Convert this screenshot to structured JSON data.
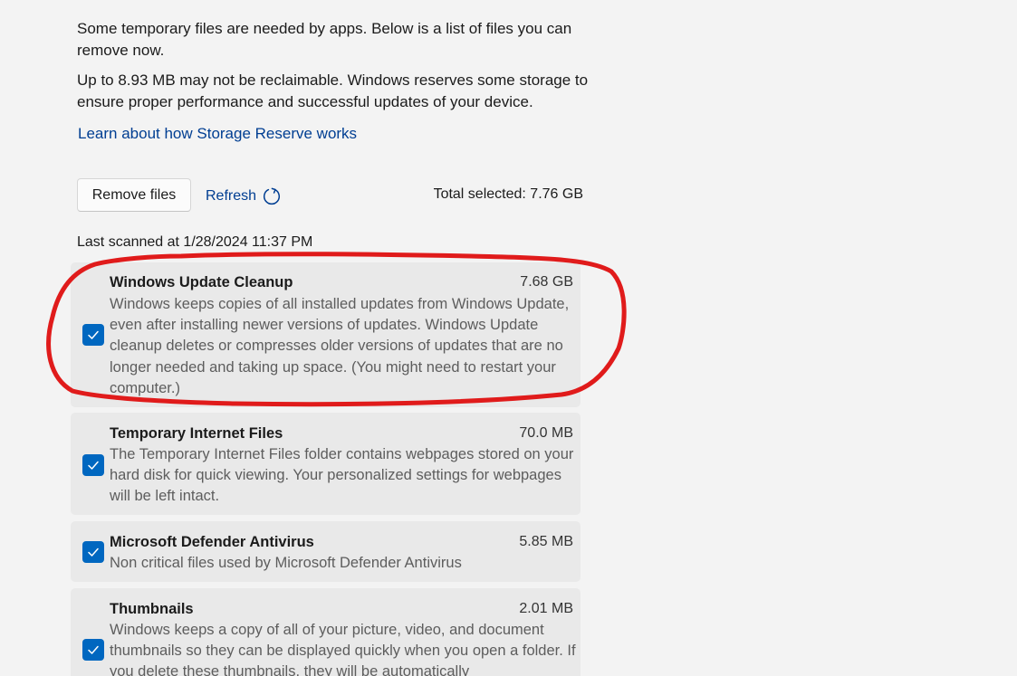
{
  "intro": {
    "paragraph1": "Some temporary files are needed by apps. Below is a list of files you can remove now.",
    "paragraph2": "Up to 8.93 MB may not be reclaimable. Windows reserves some storage to ensure proper performance and successful updates of your device.",
    "learn_link": "Learn about how Storage Reserve works"
  },
  "toolbar": {
    "remove_label": "Remove files",
    "refresh_label": "Refresh",
    "total_selected": "Total selected: 7.76 GB"
  },
  "last_scanned": "Last scanned at 1/28/2024 11:37 PM",
  "items": [
    {
      "title": "Windows Update Cleanup",
      "size": "7.68 GB",
      "description": "Windows keeps copies of all installed updates from Windows Update, even after installing newer versions of updates. Windows Update cleanup deletes or compresses older versions of updates that are no longer needed and taking up space. (You might need to restart your computer.)",
      "checked": true
    },
    {
      "title": "Temporary Internet Files",
      "size": "70.0 MB",
      "description": "The Temporary Internet Files folder contains webpages stored on your hard disk for quick viewing. Your personalized settings for webpages will be left intact.",
      "checked": true
    },
    {
      "title": "Microsoft Defender Antivirus",
      "size": "5.85 MB",
      "description": "Non critical files used by Microsoft Defender Antivirus",
      "checked": true
    },
    {
      "title": "Thumbnails",
      "size": "2.01 MB",
      "description": "Windows keeps a copy of all of your picture, video, and document thumbnails so they can be displayed quickly when you open a folder. If you delete these thumbnails, they will be automatically",
      "checked": true
    }
  ],
  "colors": {
    "accent": "#0067c0",
    "link": "#003e92",
    "annotation": "#e01b1b"
  },
  "icons": {
    "refresh": "refresh-icon",
    "check": "checkmark-icon"
  }
}
